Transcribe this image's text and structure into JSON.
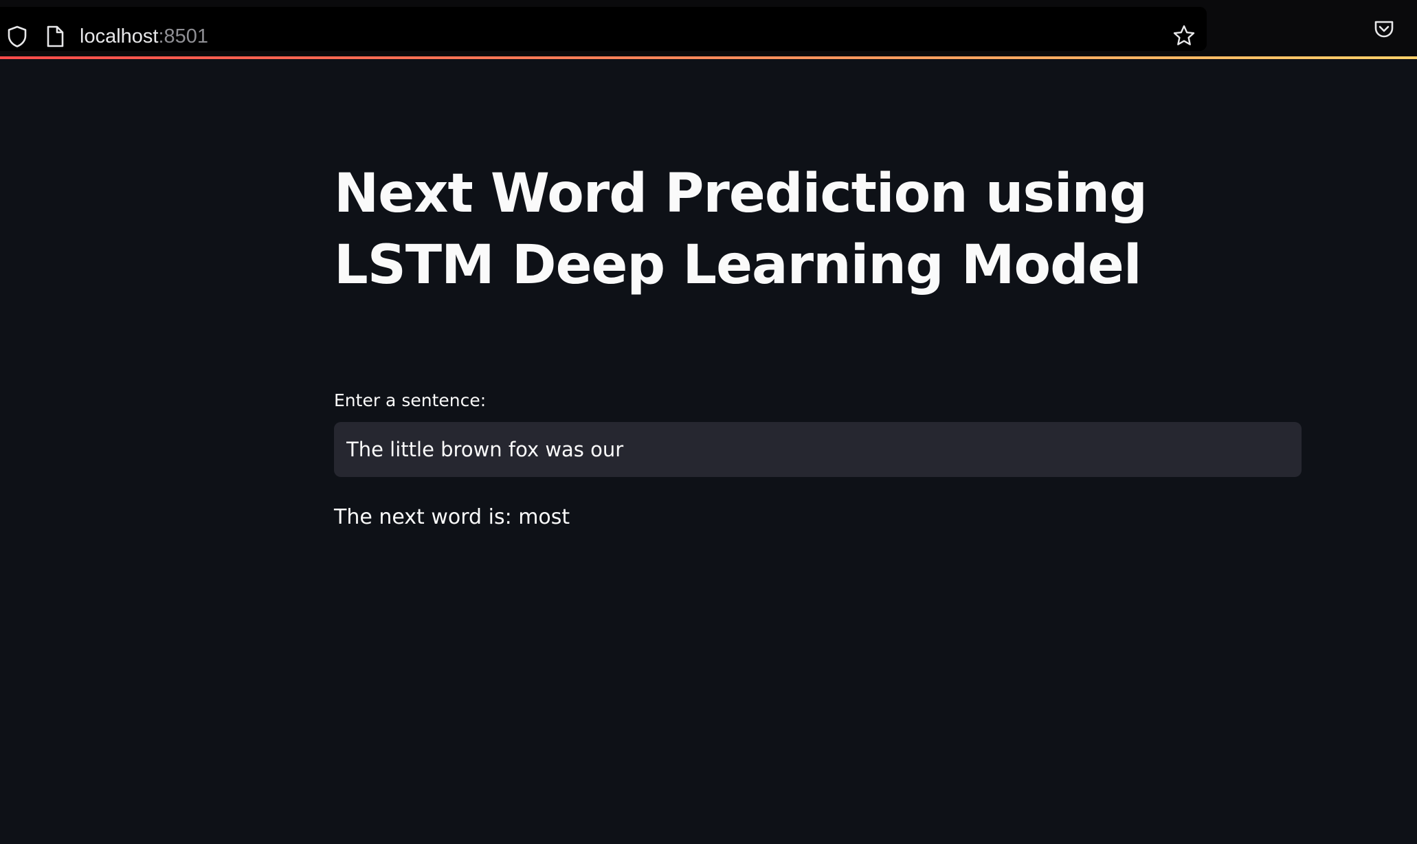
{
  "browser": {
    "url_host": "localhost",
    "url_port": ":8501",
    "icons": {
      "shield": "shield-icon",
      "page": "page-icon",
      "bookmark": "star-icon",
      "pocket": "pocket-icon"
    }
  },
  "theme": {
    "background": "#0e1117",
    "input_background": "#262730",
    "text": "#fafafa",
    "accent_gradient": [
      "#ff4b4b",
      "#ffd16a"
    ]
  },
  "main": {
    "title": "Next Word Prediction using LSTM Deep Learning Model",
    "input_label": "Enter a sentence:",
    "input_value": "The little brown fox was our",
    "result": "The next word is: most"
  }
}
